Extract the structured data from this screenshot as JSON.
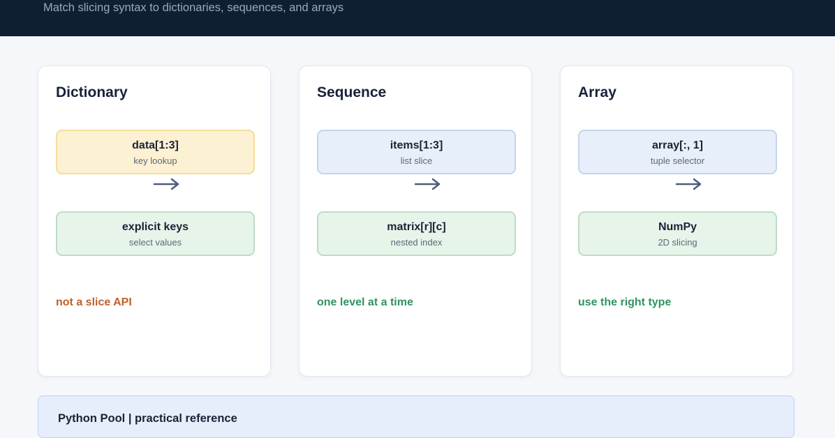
{
  "header": {
    "subtitle": "Match slicing syntax to dictionaries, sequences, and arrays"
  },
  "cards": [
    {
      "title": "Dictionary",
      "top_box": {
        "label": "data[1:3]",
        "sub": "key lookup",
        "color": "#fdf1d3"
      },
      "bottom_box": {
        "label": "explicit keys",
        "sub": "select values",
        "color": "#e7f4ea"
      },
      "note": {
        "text": "not a slice API",
        "color": "#c0602b"
      }
    },
    {
      "title": "Sequence",
      "top_box": {
        "label": "items[1:3]",
        "sub": "list slice",
        "color": "#e7effa"
      },
      "bottom_box": {
        "label": "matrix[r][c]",
        "sub": "nested index",
        "color": "#e7f4ea"
      },
      "note": {
        "text": "one level at a time",
        "color": "#2f9460"
      }
    },
    {
      "title": "Array",
      "top_box": {
        "label": "array[:, 1]",
        "sub": "tuple selector",
        "color": "#e7effa"
      },
      "bottom_box": {
        "label": "NumPy",
        "sub": "2D slicing",
        "color": "#e7f4ea"
      },
      "note": {
        "text": "use the right type",
        "color": "#2f9460"
      }
    }
  ],
  "footer": {
    "text": "Python Pool | practical reference"
  },
  "colors": {
    "header_bg": "#0f1f33",
    "arrow": "#4d5d7a",
    "footer_bg": "#e6eefb"
  }
}
